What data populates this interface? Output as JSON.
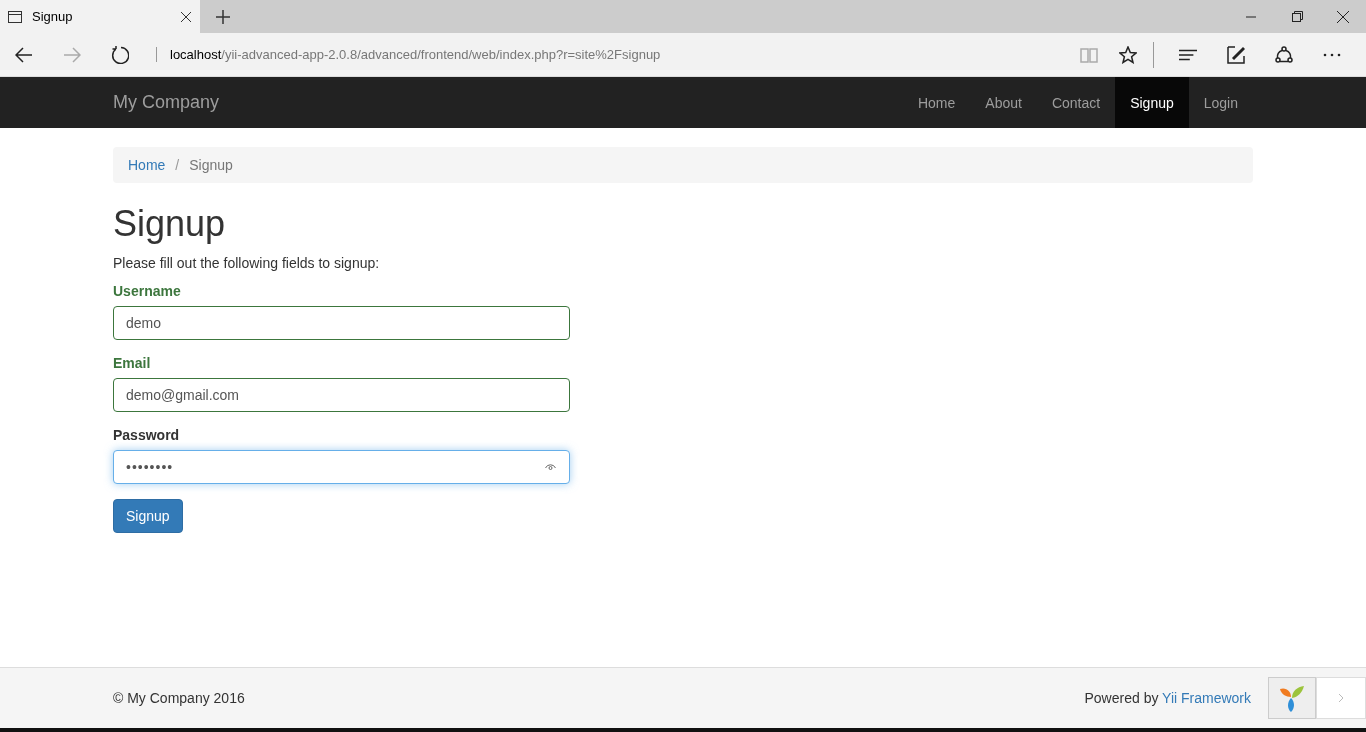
{
  "browser": {
    "tab": {
      "title": "Signup",
      "selected": true
    },
    "address": {
      "host": "localhost",
      "path": "/yii-advanced-app-2.0.8/advanced/frontend/web/index.php?r=site%2Fsignup"
    }
  },
  "navbar": {
    "brand": "My Company",
    "items": [
      {
        "label": "Home",
        "selected": false
      },
      {
        "label": "About",
        "selected": false
      },
      {
        "label": "Contact",
        "selected": false
      },
      {
        "label": "Signup",
        "selected": true
      },
      {
        "label": "Login",
        "selected": false
      }
    ]
  },
  "breadcrumb": {
    "separator": "/",
    "items": [
      {
        "label": "Home",
        "kind": "link"
      },
      {
        "label": "Signup",
        "kind": "current"
      }
    ]
  },
  "heading": "Signup",
  "intro": "Please fill out the following fields to signup:",
  "fields": [
    {
      "label": "Username",
      "value": "demo",
      "valid": true,
      "focused": false,
      "kind": "text"
    },
    {
      "label": "Email",
      "value": "demo@gmail.com",
      "valid": true,
      "focused": false,
      "kind": "text"
    },
    {
      "label": "Password",
      "value": "••••••••",
      "valid": false,
      "focused": true,
      "kind": "password"
    }
  ],
  "submit": "Signup",
  "footer": {
    "copyright": "© My Company 2016",
    "powered": "Powered by ",
    "framework": "Yii Framework"
  }
}
